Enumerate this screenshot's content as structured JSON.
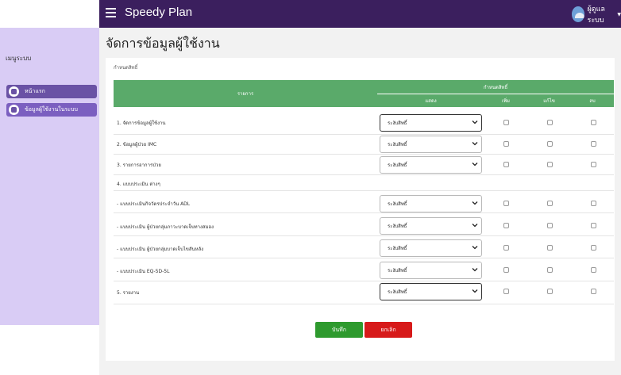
{
  "header": {
    "brand": "Speedy Plan",
    "user": "ผู้ดูแลระบบ"
  },
  "sidebar": {
    "heading": "เมนูระบบ",
    "items": [
      {
        "label": "หน้าแรก",
        "icon": "home-icon"
      },
      {
        "label": "ข้อมูลผู้ใช้งานในระบบ",
        "icon": "users-gear-icon"
      }
    ]
  },
  "main": {
    "title": "จัดการข้อมูลผู้ใช้งาน",
    "breadcrumb": "กำหนดสิทธิ์",
    "table": {
      "col_list": "รายการ",
      "col_perm": "กำหนดสิทธิ์",
      "col_show": "แสดง",
      "col_add": "เพิ่ม",
      "col_edit": "แก้ไข",
      "col_delete": "ลบ"
    },
    "select_value": "ระงับสิทธิ์",
    "rows": [
      "1. จัดการข้อมูลผู้ใช้งาน",
      "2. ข้อมูลผู้ป่วย IMC",
      "3. รายการอาการป่วย",
      "4. แบบประเมิน ต่างๆ",
      "- แบบประเมินกิจวัตรประจำวัน ADL",
      "- แบบประเมิน ผู้ป่วยกลุ่มภาวะบาดเจ็บทางสมอง",
      "- แบบประเมิน ผู้ป่วยกลุ่มบาดเจ็บไขสันหลัง",
      "- แบบประเมิน EQ-5D-5L",
      "5. รายงาน"
    ]
  },
  "buttons": {
    "save": "บันทึก",
    "cancel": "ยกเลิก"
  },
  "colors": {
    "navbar": "#3b1f5e",
    "sidebar": "#d9ccf5",
    "header_green": "#5aaa6a",
    "save": "#2e9a2e",
    "cancel": "#d71a1a"
  }
}
